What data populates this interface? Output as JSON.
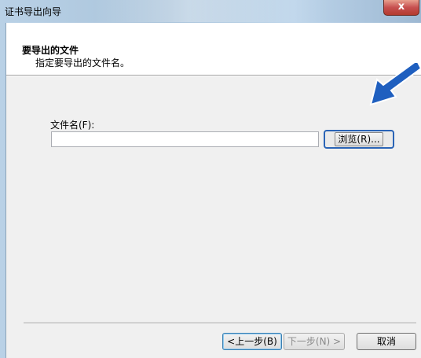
{
  "window": {
    "title": "证书导出向导",
    "close_glyph": "x"
  },
  "header": {
    "title": "要导出的文件",
    "subtitle": "指定要导出的文件名。"
  },
  "form": {
    "file_label": "文件名(F):",
    "file_value": "",
    "browse_label": "浏览(R)..."
  },
  "footer": {
    "back_label": "<上一步(B)",
    "next_label": "下一步(N) >",
    "cancel_label": "取消"
  },
  "colors": {
    "accent_arrow": "#1f5fbf",
    "focus_border": "#2a64b6"
  }
}
